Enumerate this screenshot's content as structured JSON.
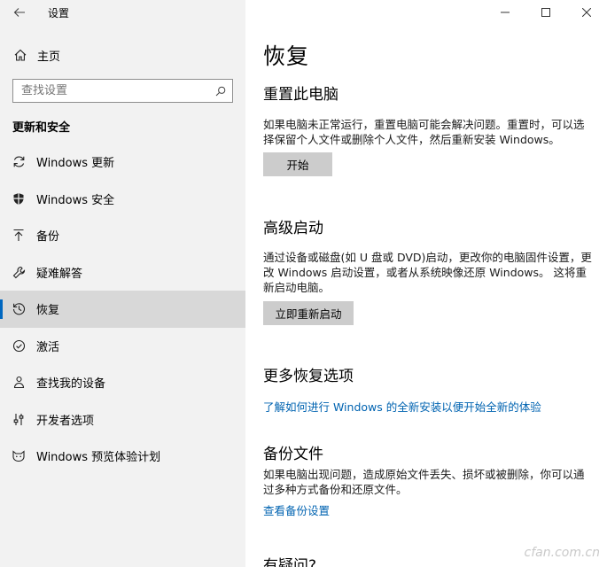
{
  "window": {
    "title": "设置"
  },
  "sidebar": {
    "home_label": "主页",
    "search_placeholder": "查找设置",
    "section_title": "更新和安全",
    "items": [
      {
        "label": "Windows 更新",
        "icon": "refresh-icon"
      },
      {
        "label": "Windows 安全",
        "icon": "shield-icon"
      },
      {
        "label": "备份",
        "icon": "backup-arrow-icon"
      },
      {
        "label": "疑难解答",
        "icon": "wrench-icon"
      },
      {
        "label": "恢复",
        "icon": "history-icon",
        "selected": true
      },
      {
        "label": "激活",
        "icon": "check-circle-icon"
      },
      {
        "label": "查找我的设备",
        "icon": "person-location-icon"
      },
      {
        "label": "开发者选项",
        "icon": "developer-sliders-icon"
      },
      {
        "label": "Windows 预览体验计划",
        "icon": "insider-cat-icon"
      }
    ]
  },
  "main": {
    "title": "恢复",
    "reset": {
      "heading": "重置此电脑",
      "description": "如果电脑未正常运行，重置电脑可能会解决问题。重置时，可以选择保留个人文件或删除个人文件，然后重新安装 Windows。",
      "button": "开始"
    },
    "advanced": {
      "heading": "高级启动",
      "description": "通过设备或磁盘(如 U 盘或 DVD)启动，更改你的电脑固件设置，更改 Windows 启动设置，或者从系统映像还原 Windows。 这将重新启动电脑。",
      "button": "立即重新启动"
    },
    "more": {
      "heading": "更多恢复选项",
      "link": "了解如何进行 Windows 的全新安装以便开始全新的体验"
    },
    "backup": {
      "heading": "备份文件",
      "description": "如果电脑出现问题，造成原始文件丢失、损坏或被删除，你可以通过多种方式备份和还原文件。",
      "link": "查看备份设置"
    },
    "question": {
      "heading": "有疑问?"
    }
  },
  "watermark": "cfan.com.cn",
  "colors": {
    "accent": "#0067c0",
    "link": "#0063b1",
    "sidebar_bg": "#f2f2f2",
    "selected_bg": "#d8d8d8",
    "button_bg": "#cccccc"
  }
}
